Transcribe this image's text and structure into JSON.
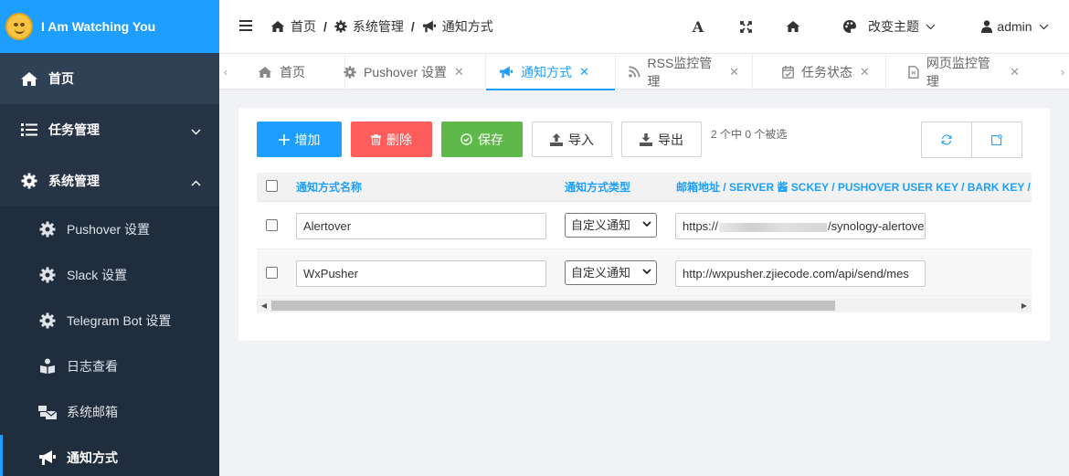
{
  "app": {
    "title": "I Am Watching You"
  },
  "sidebar": {
    "items": [
      {
        "label": "首页",
        "icon": "home-icon"
      },
      {
        "label": "任务管理",
        "icon": "list-icon",
        "expanded": false
      },
      {
        "label": "系统管理",
        "icon": "gear-icon",
        "expanded": true
      }
    ],
    "sub_items": [
      {
        "label": "Pushover 设置",
        "icon": "gear-icon"
      },
      {
        "label": "Slack 设置",
        "icon": "gear-icon"
      },
      {
        "label": "Telegram Bot 设置",
        "icon": "gear-icon"
      },
      {
        "label": "日志查看",
        "icon": "book-reader-icon"
      },
      {
        "label": "系统邮箱",
        "icon": "mail-bulk-icon"
      },
      {
        "label": "通知方式",
        "icon": "bullhorn-icon",
        "active": true
      }
    ]
  },
  "header": {
    "breadcrumb": [
      {
        "label": "首页",
        "icon": "home-icon"
      },
      {
        "label": "系统管理",
        "icon": "gear-icon"
      },
      {
        "label": "通知方式",
        "icon": "bullhorn-icon"
      }
    ],
    "font_button": "A",
    "theme_label": "改变主题",
    "user_label": "admin"
  },
  "tabs": [
    {
      "label": "首页",
      "icon": "home-icon",
      "closable": false
    },
    {
      "label": "Pushover 设置",
      "icon": "gear-icon",
      "closable": true
    },
    {
      "label": "通知方式",
      "icon": "bullhorn-icon",
      "closable": true,
      "active": true
    },
    {
      "label": "RSS监控管理",
      "icon": "rss-icon",
      "closable": true
    },
    {
      "label": "任务状态",
      "icon": "calendar-check-icon",
      "closable": true
    },
    {
      "label": "网页监控管理",
      "icon": "file-icon",
      "closable": true
    }
  ],
  "toolbar": {
    "add_label": "增加",
    "delete_label": "删除",
    "save_label": "保存",
    "import_label": "导入",
    "export_label": "导出",
    "selection_info": "2 个中 0 个被选",
    "colors": {
      "add": "#1e9fff",
      "delete": "#ff5c5c",
      "save": "#5fb84a"
    }
  },
  "table": {
    "headers": {
      "name": "通知方式名称",
      "type": "通知方式类型",
      "address": "邮箱地址 / SERVER 酱 SCKEY / PUSHOVER USER KEY / BARK KEY / 自定"
    },
    "rows": [
      {
        "name": "Alertover",
        "type": "自定义通知",
        "address_prefix": "https://",
        "address_suffix": "/synology-alertove",
        "checked": false
      },
      {
        "name": "WxPusher",
        "type": "自定义通知",
        "address_prefix": "http://wxpusher.zjiecode.com/api/send/mes",
        "address_suffix": "",
        "checked": false
      }
    ]
  }
}
